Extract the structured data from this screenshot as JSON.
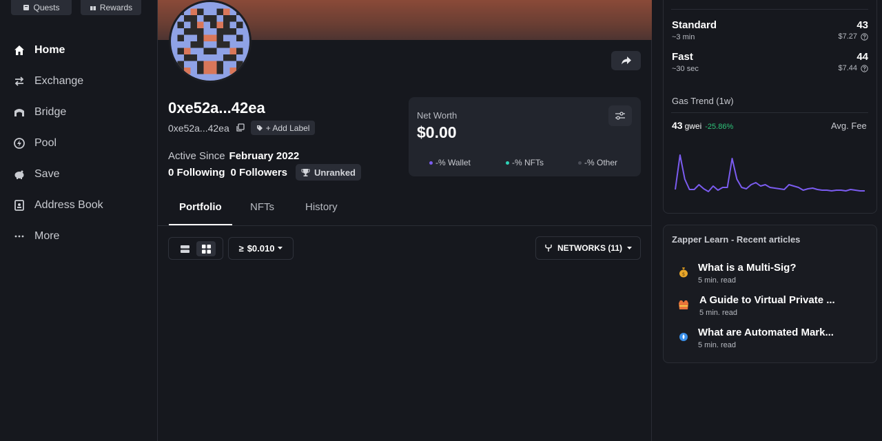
{
  "sidebar": {
    "chips": {
      "quests": "Quests",
      "rewards": "Rewards"
    },
    "items": [
      {
        "label": "Home",
        "icon": "home-icon"
      },
      {
        "label": "Exchange",
        "icon": "exchange-icon"
      },
      {
        "label": "Bridge",
        "icon": "bridge-icon"
      },
      {
        "label": "Pool",
        "icon": "pool-icon"
      },
      {
        "label": "Save",
        "icon": "piggy-bank-icon"
      },
      {
        "label": "Address Book",
        "icon": "address-book-icon"
      },
      {
        "label": "More",
        "icon": "more-icon"
      }
    ]
  },
  "profile": {
    "title": "0xe52a...42ea",
    "address": "0xe52a...42ea",
    "add_label": "+ Add Label",
    "active_since_label": "Active Since",
    "active_since_value": "February 2022",
    "following": "0 Following",
    "followers": "0 Followers",
    "rank": "Unranked"
  },
  "networth": {
    "label": "Net Worth",
    "value": "$0.00",
    "legend": [
      {
        "label": "-% Wallet",
        "color": "#7b5cf0"
      },
      {
        "label": "-% NFTs",
        "color": "#2ed3b7"
      },
      {
        "label": "-% Other",
        "color": "#4a4d57"
      }
    ]
  },
  "tabs": [
    "Portfolio",
    "NFTs",
    "History"
  ],
  "filters": {
    "min_value_symbol": "≥",
    "min_value": "$0.010",
    "networks": "NETWORKS (11)"
  },
  "gas": {
    "rows": [
      {
        "name": "Standard",
        "value": "43",
        "time": "~3 min",
        "usd": "$7.27"
      },
      {
        "name": "Fast",
        "value": "44",
        "time": "~30 sec",
        "usd": "$7.44"
      }
    ],
    "trend_title": "Gas Trend (1w)",
    "trend_value": "43",
    "trend_unit": "gwei",
    "trend_change": "-25.86%",
    "avg_fee_label": "Avg. Fee",
    "accent": "#7b5cf0"
  },
  "chart_data": {
    "type": "line",
    "title": "Gas Trend (1w)",
    "x": [
      0,
      1,
      2,
      3,
      4,
      5,
      6,
      7,
      8,
      9,
      10,
      11,
      12,
      13,
      14,
      15,
      16,
      17,
      18,
      19,
      20,
      21,
      22,
      23,
      24,
      25,
      26,
      27,
      28,
      29,
      30,
      31,
      32,
      33,
      34,
      35,
      36,
      37,
      38,
      39,
      40
    ],
    "series": [
      {
        "values": [
          45,
          95,
          60,
          45,
          45,
          52,
          46,
          42,
          50,
          44,
          48,
          48,
          90,
          60,
          48,
          46,
          52,
          55,
          50,
          52,
          48,
          47,
          46,
          45,
          52,
          50,
          48,
          44,
          46,
          47,
          45,
          44,
          44,
          43,
          44,
          44,
          43,
          45,
          44,
          43,
          43
        ]
      }
    ],
    "ylim": [
      30,
      110
    ]
  },
  "learn": {
    "title": "Zapper Learn - Recent articles",
    "articles": [
      {
        "title": "What is a Multi-Sig?",
        "read": "5 min. read",
        "icon": "money-bag-icon"
      },
      {
        "title": "A Guide to Virtual Private ...",
        "read": "5 min. read",
        "icon": "vest-icon"
      },
      {
        "title": "What are Automated Mark...",
        "read": "5 min. read",
        "icon": "droplet-icon"
      }
    ]
  }
}
